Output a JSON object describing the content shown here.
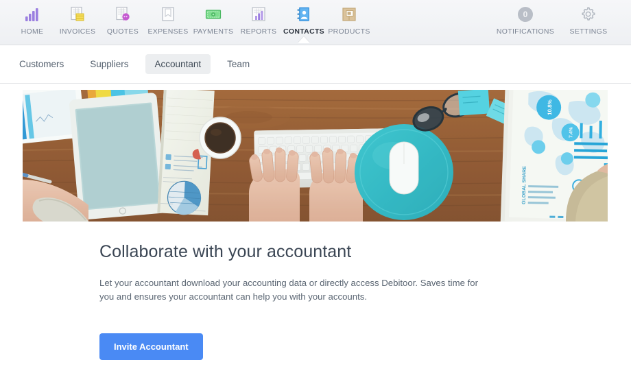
{
  "app": {
    "accent_blue": "#4a8af4",
    "header_bg": "#f1f3f5"
  },
  "topnav": {
    "items": [
      {
        "label": "HOME",
        "icon": "bar-chart-icon",
        "active": false
      },
      {
        "label": "INVOICES",
        "icon": "invoice-icon",
        "active": false
      },
      {
        "label": "QUOTES",
        "icon": "quote-icon",
        "active": false
      },
      {
        "label": "EXPENSES",
        "icon": "expense-icon",
        "active": false
      },
      {
        "label": "PAYMENTS",
        "icon": "banknote-icon",
        "active": false
      },
      {
        "label": "REPORTS",
        "icon": "report-icon",
        "active": false
      },
      {
        "label": "CONTACTS",
        "icon": "address-book-icon",
        "active": true
      },
      {
        "label": "PRODUCTS",
        "icon": "package-icon",
        "active": false
      }
    ],
    "right": {
      "notifications_label": "NOTIFICATIONS",
      "notifications_count": "0",
      "settings_label": "SETTINGS"
    }
  },
  "subnav": {
    "tabs": [
      {
        "label": "Customers",
        "active": false
      },
      {
        "label": "Suppliers",
        "active": false
      },
      {
        "label": "Accountant",
        "active": true
      },
      {
        "label": "Team",
        "active": false
      }
    ]
  },
  "hero": {
    "alt": "Overhead photo of a wooden desk with hands typing on a keyboard, tablet, coffee cup, teal mousepad with mouse, glasses, sticky notes and printed charts"
  },
  "main": {
    "headline": "Collaborate with your accountant",
    "body": "Let your accountant download your accounting data or directly access Debitoor. Saves time for you and ensures your accountant can help you with your accounts.",
    "cta_label": "Invite Accountant"
  }
}
